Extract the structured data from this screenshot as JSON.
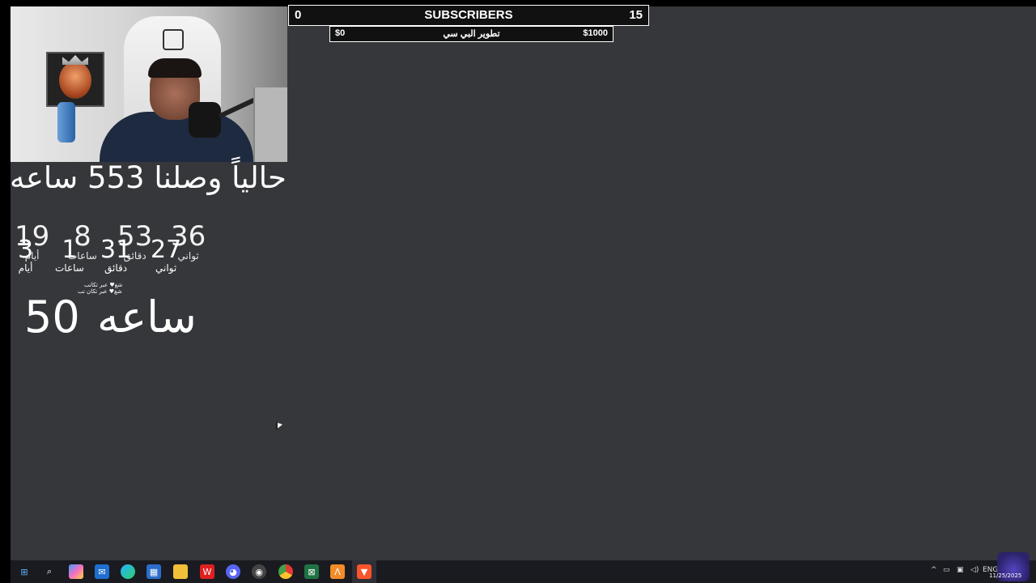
{
  "subscriber_goal": {
    "min": "0",
    "title": "SUBSCRIBERS",
    "max": "15"
  },
  "donation_goal": {
    "min": "$0",
    "title": "تطوير البي سي",
    "max": "$1000"
  },
  "hours_reached": "حالياً وصلنا 553 ساعه",
  "countdown_back": {
    "days": "19",
    "days_label": "أيام",
    "hours": "8",
    "hours_label": "ساعات",
    "minutes": "53",
    "minutes_label": "دقائق",
    "seconds": "36",
    "seconds_label": "ثواني"
  },
  "countdown_front": {
    "days": "3",
    "days_label": "أيام",
    "hours": "1",
    "hours_label": "ساعات",
    "minutes": "31",
    "minutes_label": "دقائق",
    "seconds": "27",
    "seconds_label": "ثواني"
  },
  "small_caption_1": "شغ♥ عبر تكاتب",
  "small_caption_2": "شغ♥ عبر تكان تب",
  "big_hours": {
    "number": "50",
    "word": "ساعه"
  },
  "tray": {
    "lang": "ENG",
    "date": "11/25/2025"
  },
  "taskbar_icons": [
    "windows-icon",
    "search-icon",
    "copilot-icon",
    "mail-icon",
    "edge-icon",
    "store-icon",
    "files-icon",
    "wps-icon",
    "discord-icon",
    "obs-icon",
    "chrome-icon",
    "excel-icon",
    "app-icon",
    "brave-icon"
  ]
}
